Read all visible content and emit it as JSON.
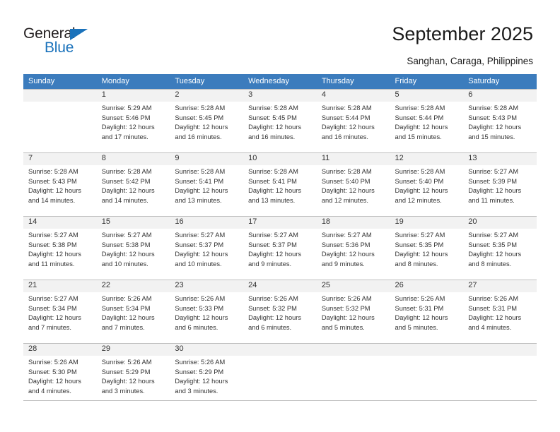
{
  "brand": {
    "name_part1": "General",
    "name_part2": "Blue",
    "triangle_icon": "triangle-icon",
    "accent_color": "#1a72bb"
  },
  "header": {
    "title": "September 2025",
    "subtitle": "Sanghan, Caraga, Philippines"
  },
  "calendar": {
    "header_bg": "#3c7cbd",
    "weekday_headers": [
      "Sunday",
      "Monday",
      "Tuesday",
      "Wednesday",
      "Thursday",
      "Friday",
      "Saturday"
    ],
    "labels": {
      "sunrise": "Sunrise:",
      "sunset": "Sunset:",
      "daylight": "Daylight:"
    },
    "weeks": [
      [
        {
          "day": "",
          "sunrise": "",
          "sunset": "",
          "daylight_line1": "",
          "daylight_line2": ""
        },
        {
          "day": "1",
          "sunrise": "Sunrise: 5:29 AM",
          "sunset": "Sunset: 5:46 PM",
          "daylight_line1": "Daylight: 12 hours",
          "daylight_line2": "and 17 minutes."
        },
        {
          "day": "2",
          "sunrise": "Sunrise: 5:28 AM",
          "sunset": "Sunset: 5:45 PM",
          "daylight_line1": "Daylight: 12 hours",
          "daylight_line2": "and 16 minutes."
        },
        {
          "day": "3",
          "sunrise": "Sunrise: 5:28 AM",
          "sunset": "Sunset: 5:45 PM",
          "daylight_line1": "Daylight: 12 hours",
          "daylight_line2": "and 16 minutes."
        },
        {
          "day": "4",
          "sunrise": "Sunrise: 5:28 AM",
          "sunset": "Sunset: 5:44 PM",
          "daylight_line1": "Daylight: 12 hours",
          "daylight_line2": "and 16 minutes."
        },
        {
          "day": "5",
          "sunrise": "Sunrise: 5:28 AM",
          "sunset": "Sunset: 5:44 PM",
          "daylight_line1": "Daylight: 12 hours",
          "daylight_line2": "and 15 minutes."
        },
        {
          "day": "6",
          "sunrise": "Sunrise: 5:28 AM",
          "sunset": "Sunset: 5:43 PM",
          "daylight_line1": "Daylight: 12 hours",
          "daylight_line2": "and 15 minutes."
        }
      ],
      [
        {
          "day": "7",
          "sunrise": "Sunrise: 5:28 AM",
          "sunset": "Sunset: 5:43 PM",
          "daylight_line1": "Daylight: 12 hours",
          "daylight_line2": "and 14 minutes."
        },
        {
          "day": "8",
          "sunrise": "Sunrise: 5:28 AM",
          "sunset": "Sunset: 5:42 PM",
          "daylight_line1": "Daylight: 12 hours",
          "daylight_line2": "and 14 minutes."
        },
        {
          "day": "9",
          "sunrise": "Sunrise: 5:28 AM",
          "sunset": "Sunset: 5:41 PM",
          "daylight_line1": "Daylight: 12 hours",
          "daylight_line2": "and 13 minutes."
        },
        {
          "day": "10",
          "sunrise": "Sunrise: 5:28 AM",
          "sunset": "Sunset: 5:41 PM",
          "daylight_line1": "Daylight: 12 hours",
          "daylight_line2": "and 13 minutes."
        },
        {
          "day": "11",
          "sunrise": "Sunrise: 5:28 AM",
          "sunset": "Sunset: 5:40 PM",
          "daylight_line1": "Daylight: 12 hours",
          "daylight_line2": "and 12 minutes."
        },
        {
          "day": "12",
          "sunrise": "Sunrise: 5:28 AM",
          "sunset": "Sunset: 5:40 PM",
          "daylight_line1": "Daylight: 12 hours",
          "daylight_line2": "and 12 minutes."
        },
        {
          "day": "13",
          "sunrise": "Sunrise: 5:27 AM",
          "sunset": "Sunset: 5:39 PM",
          "daylight_line1": "Daylight: 12 hours",
          "daylight_line2": "and 11 minutes."
        }
      ],
      [
        {
          "day": "14",
          "sunrise": "Sunrise: 5:27 AM",
          "sunset": "Sunset: 5:38 PM",
          "daylight_line1": "Daylight: 12 hours",
          "daylight_line2": "and 11 minutes."
        },
        {
          "day": "15",
          "sunrise": "Sunrise: 5:27 AM",
          "sunset": "Sunset: 5:38 PM",
          "daylight_line1": "Daylight: 12 hours",
          "daylight_line2": "and 10 minutes."
        },
        {
          "day": "16",
          "sunrise": "Sunrise: 5:27 AM",
          "sunset": "Sunset: 5:37 PM",
          "daylight_line1": "Daylight: 12 hours",
          "daylight_line2": "and 10 minutes."
        },
        {
          "day": "17",
          "sunrise": "Sunrise: 5:27 AM",
          "sunset": "Sunset: 5:37 PM",
          "daylight_line1": "Daylight: 12 hours",
          "daylight_line2": "and 9 minutes."
        },
        {
          "day": "18",
          "sunrise": "Sunrise: 5:27 AM",
          "sunset": "Sunset: 5:36 PM",
          "daylight_line1": "Daylight: 12 hours",
          "daylight_line2": "and 9 minutes."
        },
        {
          "day": "19",
          "sunrise": "Sunrise: 5:27 AM",
          "sunset": "Sunset: 5:35 PM",
          "daylight_line1": "Daylight: 12 hours",
          "daylight_line2": "and 8 minutes."
        },
        {
          "day": "20",
          "sunrise": "Sunrise: 5:27 AM",
          "sunset": "Sunset: 5:35 PM",
          "daylight_line1": "Daylight: 12 hours",
          "daylight_line2": "and 8 minutes."
        }
      ],
      [
        {
          "day": "21",
          "sunrise": "Sunrise: 5:27 AM",
          "sunset": "Sunset: 5:34 PM",
          "daylight_line1": "Daylight: 12 hours",
          "daylight_line2": "and 7 minutes."
        },
        {
          "day": "22",
          "sunrise": "Sunrise: 5:26 AM",
          "sunset": "Sunset: 5:34 PM",
          "daylight_line1": "Daylight: 12 hours",
          "daylight_line2": "and 7 minutes."
        },
        {
          "day": "23",
          "sunrise": "Sunrise: 5:26 AM",
          "sunset": "Sunset: 5:33 PM",
          "daylight_line1": "Daylight: 12 hours",
          "daylight_line2": "and 6 minutes."
        },
        {
          "day": "24",
          "sunrise": "Sunrise: 5:26 AM",
          "sunset": "Sunset: 5:32 PM",
          "daylight_line1": "Daylight: 12 hours",
          "daylight_line2": "and 6 minutes."
        },
        {
          "day": "25",
          "sunrise": "Sunrise: 5:26 AM",
          "sunset": "Sunset: 5:32 PM",
          "daylight_line1": "Daylight: 12 hours",
          "daylight_line2": "and 5 minutes."
        },
        {
          "day": "26",
          "sunrise": "Sunrise: 5:26 AM",
          "sunset": "Sunset: 5:31 PM",
          "daylight_line1": "Daylight: 12 hours",
          "daylight_line2": "and 5 minutes."
        },
        {
          "day": "27",
          "sunrise": "Sunrise: 5:26 AM",
          "sunset": "Sunset: 5:31 PM",
          "daylight_line1": "Daylight: 12 hours",
          "daylight_line2": "and 4 minutes."
        }
      ],
      [
        {
          "day": "28",
          "sunrise": "Sunrise: 5:26 AM",
          "sunset": "Sunset: 5:30 PM",
          "daylight_line1": "Daylight: 12 hours",
          "daylight_line2": "and 4 minutes."
        },
        {
          "day": "29",
          "sunrise": "Sunrise: 5:26 AM",
          "sunset": "Sunset: 5:29 PM",
          "daylight_line1": "Daylight: 12 hours",
          "daylight_line2": "and 3 minutes."
        },
        {
          "day": "30",
          "sunrise": "Sunrise: 5:26 AM",
          "sunset": "Sunset: 5:29 PM",
          "daylight_line1": "Daylight: 12 hours",
          "daylight_line2": "and 3 minutes."
        },
        {
          "day": "",
          "sunrise": "",
          "sunset": "",
          "daylight_line1": "",
          "daylight_line2": ""
        },
        {
          "day": "",
          "sunrise": "",
          "sunset": "",
          "daylight_line1": "",
          "daylight_line2": ""
        },
        {
          "day": "",
          "sunrise": "",
          "sunset": "",
          "daylight_line1": "",
          "daylight_line2": ""
        },
        {
          "day": "",
          "sunrise": "",
          "sunset": "",
          "daylight_line1": "",
          "daylight_line2": ""
        }
      ]
    ]
  }
}
